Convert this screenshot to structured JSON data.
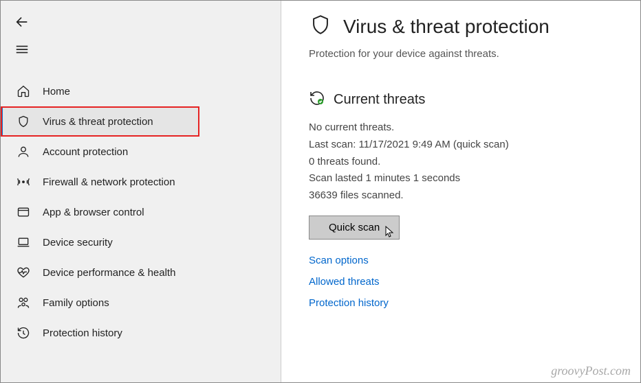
{
  "sidebar": {
    "items": [
      {
        "label": "Home"
      },
      {
        "label": "Virus & threat protection"
      },
      {
        "label": "Account protection"
      },
      {
        "label": "Firewall & network protection"
      },
      {
        "label": "App & browser control"
      },
      {
        "label": "Device security"
      },
      {
        "label": "Device performance & health"
      },
      {
        "label": "Family options"
      },
      {
        "label": "Protection history"
      }
    ]
  },
  "page": {
    "title": "Virus & threat protection",
    "subtitle": "Protection for your device against threats."
  },
  "threats": {
    "section_title": "Current threats",
    "status": "No current threats.",
    "last_scan": "Last scan: 11/17/2021 9:49 AM (quick scan)",
    "found": "0 threats found.",
    "duration": "Scan lasted 1 minutes 1 seconds",
    "files": "36639 files scanned."
  },
  "buttons": {
    "quick_scan": "Quick scan"
  },
  "links": {
    "scan_options": "Scan options",
    "allowed_threats": "Allowed threats",
    "protection_history": "Protection history"
  },
  "watermark": "groovyPost.com"
}
